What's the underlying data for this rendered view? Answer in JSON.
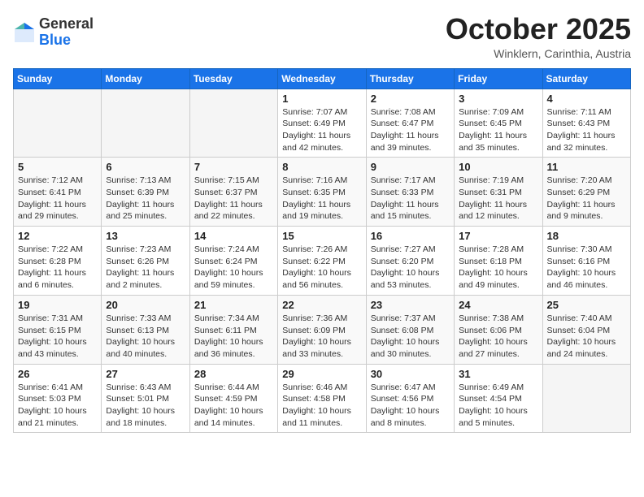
{
  "header": {
    "logo_general": "General",
    "logo_blue": "Blue",
    "month": "October 2025",
    "location": "Winklern, Carinthia, Austria"
  },
  "weekdays": [
    "Sunday",
    "Monday",
    "Tuesday",
    "Wednesday",
    "Thursday",
    "Friday",
    "Saturday"
  ],
  "weeks": [
    [
      {
        "day": "",
        "info": ""
      },
      {
        "day": "",
        "info": ""
      },
      {
        "day": "",
        "info": ""
      },
      {
        "day": "1",
        "info": "Sunrise: 7:07 AM\nSunset: 6:49 PM\nDaylight: 11 hours and 42 minutes."
      },
      {
        "day": "2",
        "info": "Sunrise: 7:08 AM\nSunset: 6:47 PM\nDaylight: 11 hours and 39 minutes."
      },
      {
        "day": "3",
        "info": "Sunrise: 7:09 AM\nSunset: 6:45 PM\nDaylight: 11 hours and 35 minutes."
      },
      {
        "day": "4",
        "info": "Sunrise: 7:11 AM\nSunset: 6:43 PM\nDaylight: 11 hours and 32 minutes."
      }
    ],
    [
      {
        "day": "5",
        "info": "Sunrise: 7:12 AM\nSunset: 6:41 PM\nDaylight: 11 hours and 29 minutes."
      },
      {
        "day": "6",
        "info": "Sunrise: 7:13 AM\nSunset: 6:39 PM\nDaylight: 11 hours and 25 minutes."
      },
      {
        "day": "7",
        "info": "Sunrise: 7:15 AM\nSunset: 6:37 PM\nDaylight: 11 hours and 22 minutes."
      },
      {
        "day": "8",
        "info": "Sunrise: 7:16 AM\nSunset: 6:35 PM\nDaylight: 11 hours and 19 minutes."
      },
      {
        "day": "9",
        "info": "Sunrise: 7:17 AM\nSunset: 6:33 PM\nDaylight: 11 hours and 15 minutes."
      },
      {
        "day": "10",
        "info": "Sunrise: 7:19 AM\nSunset: 6:31 PM\nDaylight: 11 hours and 12 minutes."
      },
      {
        "day": "11",
        "info": "Sunrise: 7:20 AM\nSunset: 6:29 PM\nDaylight: 11 hours and 9 minutes."
      }
    ],
    [
      {
        "day": "12",
        "info": "Sunrise: 7:22 AM\nSunset: 6:28 PM\nDaylight: 11 hours and 6 minutes."
      },
      {
        "day": "13",
        "info": "Sunrise: 7:23 AM\nSunset: 6:26 PM\nDaylight: 11 hours and 2 minutes."
      },
      {
        "day": "14",
        "info": "Sunrise: 7:24 AM\nSunset: 6:24 PM\nDaylight: 10 hours and 59 minutes."
      },
      {
        "day": "15",
        "info": "Sunrise: 7:26 AM\nSunset: 6:22 PM\nDaylight: 10 hours and 56 minutes."
      },
      {
        "day": "16",
        "info": "Sunrise: 7:27 AM\nSunset: 6:20 PM\nDaylight: 10 hours and 53 minutes."
      },
      {
        "day": "17",
        "info": "Sunrise: 7:28 AM\nSunset: 6:18 PM\nDaylight: 10 hours and 49 minutes."
      },
      {
        "day": "18",
        "info": "Sunrise: 7:30 AM\nSunset: 6:16 PM\nDaylight: 10 hours and 46 minutes."
      }
    ],
    [
      {
        "day": "19",
        "info": "Sunrise: 7:31 AM\nSunset: 6:15 PM\nDaylight: 10 hours and 43 minutes."
      },
      {
        "day": "20",
        "info": "Sunrise: 7:33 AM\nSunset: 6:13 PM\nDaylight: 10 hours and 40 minutes."
      },
      {
        "day": "21",
        "info": "Sunrise: 7:34 AM\nSunset: 6:11 PM\nDaylight: 10 hours and 36 minutes."
      },
      {
        "day": "22",
        "info": "Sunrise: 7:36 AM\nSunset: 6:09 PM\nDaylight: 10 hours and 33 minutes."
      },
      {
        "day": "23",
        "info": "Sunrise: 7:37 AM\nSunset: 6:08 PM\nDaylight: 10 hours and 30 minutes."
      },
      {
        "day": "24",
        "info": "Sunrise: 7:38 AM\nSunset: 6:06 PM\nDaylight: 10 hours and 27 minutes."
      },
      {
        "day": "25",
        "info": "Sunrise: 7:40 AM\nSunset: 6:04 PM\nDaylight: 10 hours and 24 minutes."
      }
    ],
    [
      {
        "day": "26",
        "info": "Sunrise: 6:41 AM\nSunset: 5:03 PM\nDaylight: 10 hours and 21 minutes."
      },
      {
        "day": "27",
        "info": "Sunrise: 6:43 AM\nSunset: 5:01 PM\nDaylight: 10 hours and 18 minutes."
      },
      {
        "day": "28",
        "info": "Sunrise: 6:44 AM\nSunset: 4:59 PM\nDaylight: 10 hours and 14 minutes."
      },
      {
        "day": "29",
        "info": "Sunrise: 6:46 AM\nSunset: 4:58 PM\nDaylight: 10 hours and 11 minutes."
      },
      {
        "day": "30",
        "info": "Sunrise: 6:47 AM\nSunset: 4:56 PM\nDaylight: 10 hours and 8 minutes."
      },
      {
        "day": "31",
        "info": "Sunrise: 6:49 AM\nSunset: 4:54 PM\nDaylight: 10 hours and 5 minutes."
      },
      {
        "day": "",
        "info": ""
      }
    ]
  ]
}
